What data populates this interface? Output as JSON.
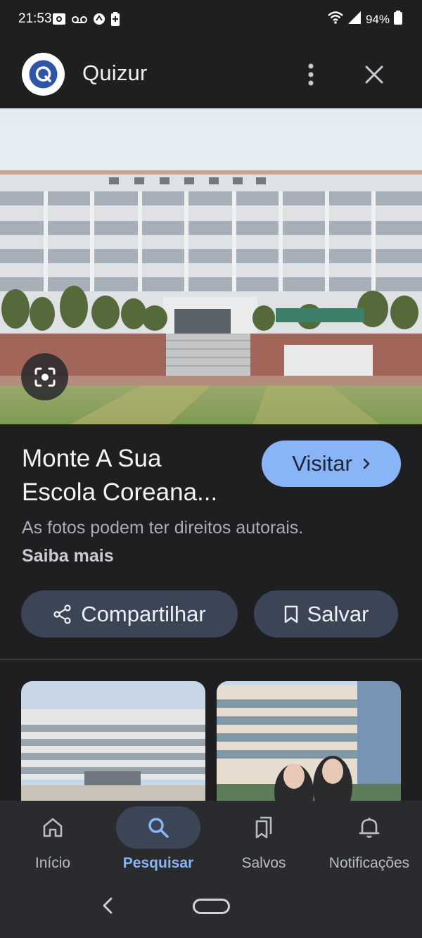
{
  "status_bar": {
    "time": "21:53",
    "battery": "94%",
    "left_icons": [
      "screenshot-icon",
      "voicemail-icon",
      "sync-icon",
      "battery-saver-icon"
    ],
    "right_icons": [
      "wifi-icon",
      "signal-icon",
      "battery-icon"
    ]
  },
  "header": {
    "app_title": "Quizur",
    "logo_letter": "Q",
    "more_icon": "more-vertical-icon",
    "close_icon": "close-icon"
  },
  "result": {
    "title_line1": "Monte A Sua",
    "title_line2": "Escola Coreana...",
    "visit_label": "Visitar",
    "copyright_text": "As fotos podem ter direitos autorais.",
    "learn_more": "Saiba mais",
    "share_label": "Compartilhar",
    "save_label": "Salvar"
  },
  "bottom_nav": {
    "items": [
      {
        "label": "Início",
        "icon": "home-icon"
      },
      {
        "label": "Pesquisar",
        "icon": "search-icon",
        "active": true
      },
      {
        "label": "Salvos",
        "icon": "bookmarks-icon"
      },
      {
        "label": "Notificações",
        "icon": "bell-icon"
      }
    ]
  },
  "colors": {
    "background": "#1f1f22",
    "accent": "#8ab4f8",
    "pill": "#3c4556",
    "nav_bg": "#2a2b2f"
  }
}
